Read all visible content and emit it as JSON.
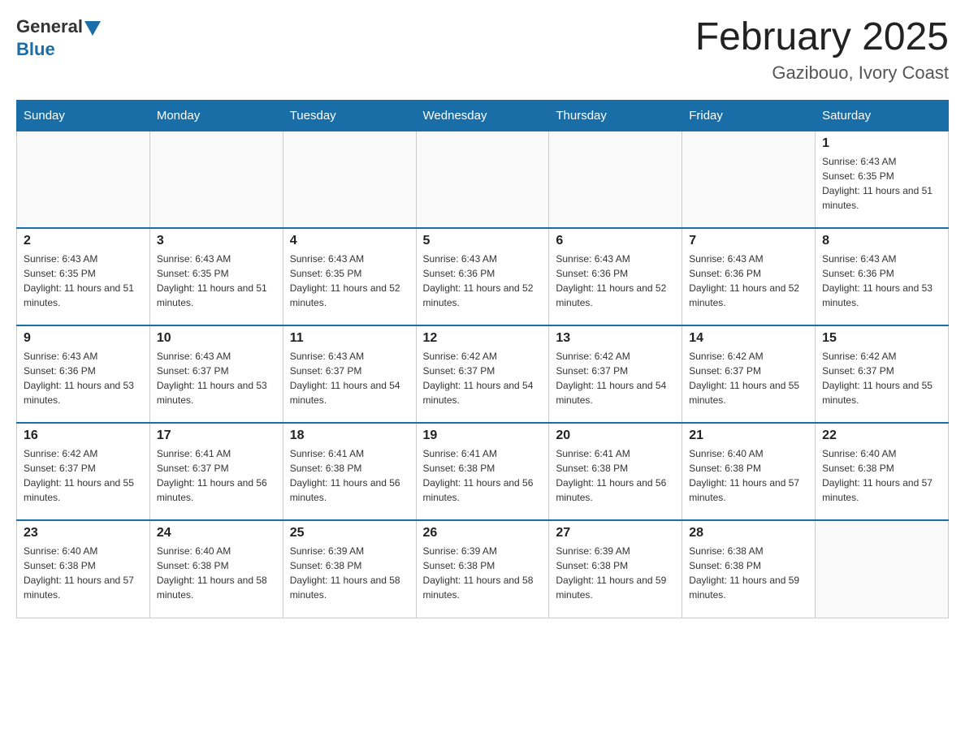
{
  "header": {
    "logo_general": "General",
    "logo_blue": "Blue",
    "month_title": "February 2025",
    "location": "Gazibouo, Ivory Coast"
  },
  "weekdays": [
    "Sunday",
    "Monday",
    "Tuesday",
    "Wednesday",
    "Thursday",
    "Friday",
    "Saturday"
  ],
  "weeks": [
    [
      {
        "day": "",
        "sunrise": "",
        "sunset": "",
        "daylight": ""
      },
      {
        "day": "",
        "sunrise": "",
        "sunset": "",
        "daylight": ""
      },
      {
        "day": "",
        "sunrise": "",
        "sunset": "",
        "daylight": ""
      },
      {
        "day": "",
        "sunrise": "",
        "sunset": "",
        "daylight": ""
      },
      {
        "day": "",
        "sunrise": "",
        "sunset": "",
        "daylight": ""
      },
      {
        "day": "",
        "sunrise": "",
        "sunset": "",
        "daylight": ""
      },
      {
        "day": "1",
        "sunrise": "Sunrise: 6:43 AM",
        "sunset": "Sunset: 6:35 PM",
        "daylight": "Daylight: 11 hours and 51 minutes."
      }
    ],
    [
      {
        "day": "2",
        "sunrise": "Sunrise: 6:43 AM",
        "sunset": "Sunset: 6:35 PM",
        "daylight": "Daylight: 11 hours and 51 minutes."
      },
      {
        "day": "3",
        "sunrise": "Sunrise: 6:43 AM",
        "sunset": "Sunset: 6:35 PM",
        "daylight": "Daylight: 11 hours and 51 minutes."
      },
      {
        "day": "4",
        "sunrise": "Sunrise: 6:43 AM",
        "sunset": "Sunset: 6:35 PM",
        "daylight": "Daylight: 11 hours and 52 minutes."
      },
      {
        "day": "5",
        "sunrise": "Sunrise: 6:43 AM",
        "sunset": "Sunset: 6:36 PM",
        "daylight": "Daylight: 11 hours and 52 minutes."
      },
      {
        "day": "6",
        "sunrise": "Sunrise: 6:43 AM",
        "sunset": "Sunset: 6:36 PM",
        "daylight": "Daylight: 11 hours and 52 minutes."
      },
      {
        "day": "7",
        "sunrise": "Sunrise: 6:43 AM",
        "sunset": "Sunset: 6:36 PM",
        "daylight": "Daylight: 11 hours and 52 minutes."
      },
      {
        "day": "8",
        "sunrise": "Sunrise: 6:43 AM",
        "sunset": "Sunset: 6:36 PM",
        "daylight": "Daylight: 11 hours and 53 minutes."
      }
    ],
    [
      {
        "day": "9",
        "sunrise": "Sunrise: 6:43 AM",
        "sunset": "Sunset: 6:36 PM",
        "daylight": "Daylight: 11 hours and 53 minutes."
      },
      {
        "day": "10",
        "sunrise": "Sunrise: 6:43 AM",
        "sunset": "Sunset: 6:37 PM",
        "daylight": "Daylight: 11 hours and 53 minutes."
      },
      {
        "day": "11",
        "sunrise": "Sunrise: 6:43 AM",
        "sunset": "Sunset: 6:37 PM",
        "daylight": "Daylight: 11 hours and 54 minutes."
      },
      {
        "day": "12",
        "sunrise": "Sunrise: 6:42 AM",
        "sunset": "Sunset: 6:37 PM",
        "daylight": "Daylight: 11 hours and 54 minutes."
      },
      {
        "day": "13",
        "sunrise": "Sunrise: 6:42 AM",
        "sunset": "Sunset: 6:37 PM",
        "daylight": "Daylight: 11 hours and 54 minutes."
      },
      {
        "day": "14",
        "sunrise": "Sunrise: 6:42 AM",
        "sunset": "Sunset: 6:37 PM",
        "daylight": "Daylight: 11 hours and 55 minutes."
      },
      {
        "day": "15",
        "sunrise": "Sunrise: 6:42 AM",
        "sunset": "Sunset: 6:37 PM",
        "daylight": "Daylight: 11 hours and 55 minutes."
      }
    ],
    [
      {
        "day": "16",
        "sunrise": "Sunrise: 6:42 AM",
        "sunset": "Sunset: 6:37 PM",
        "daylight": "Daylight: 11 hours and 55 minutes."
      },
      {
        "day": "17",
        "sunrise": "Sunrise: 6:41 AM",
        "sunset": "Sunset: 6:37 PM",
        "daylight": "Daylight: 11 hours and 56 minutes."
      },
      {
        "day": "18",
        "sunrise": "Sunrise: 6:41 AM",
        "sunset": "Sunset: 6:38 PM",
        "daylight": "Daylight: 11 hours and 56 minutes."
      },
      {
        "day": "19",
        "sunrise": "Sunrise: 6:41 AM",
        "sunset": "Sunset: 6:38 PM",
        "daylight": "Daylight: 11 hours and 56 minutes."
      },
      {
        "day": "20",
        "sunrise": "Sunrise: 6:41 AM",
        "sunset": "Sunset: 6:38 PM",
        "daylight": "Daylight: 11 hours and 56 minutes."
      },
      {
        "day": "21",
        "sunrise": "Sunrise: 6:40 AM",
        "sunset": "Sunset: 6:38 PM",
        "daylight": "Daylight: 11 hours and 57 minutes."
      },
      {
        "day": "22",
        "sunrise": "Sunrise: 6:40 AM",
        "sunset": "Sunset: 6:38 PM",
        "daylight": "Daylight: 11 hours and 57 minutes."
      }
    ],
    [
      {
        "day": "23",
        "sunrise": "Sunrise: 6:40 AM",
        "sunset": "Sunset: 6:38 PM",
        "daylight": "Daylight: 11 hours and 57 minutes."
      },
      {
        "day": "24",
        "sunrise": "Sunrise: 6:40 AM",
        "sunset": "Sunset: 6:38 PM",
        "daylight": "Daylight: 11 hours and 58 minutes."
      },
      {
        "day": "25",
        "sunrise": "Sunrise: 6:39 AM",
        "sunset": "Sunset: 6:38 PM",
        "daylight": "Daylight: 11 hours and 58 minutes."
      },
      {
        "day": "26",
        "sunrise": "Sunrise: 6:39 AM",
        "sunset": "Sunset: 6:38 PM",
        "daylight": "Daylight: 11 hours and 58 minutes."
      },
      {
        "day": "27",
        "sunrise": "Sunrise: 6:39 AM",
        "sunset": "Sunset: 6:38 PM",
        "daylight": "Daylight: 11 hours and 59 minutes."
      },
      {
        "day": "28",
        "sunrise": "Sunrise: 6:38 AM",
        "sunset": "Sunset: 6:38 PM",
        "daylight": "Daylight: 11 hours and 59 minutes."
      },
      {
        "day": "",
        "sunrise": "",
        "sunset": "",
        "daylight": ""
      }
    ]
  ]
}
